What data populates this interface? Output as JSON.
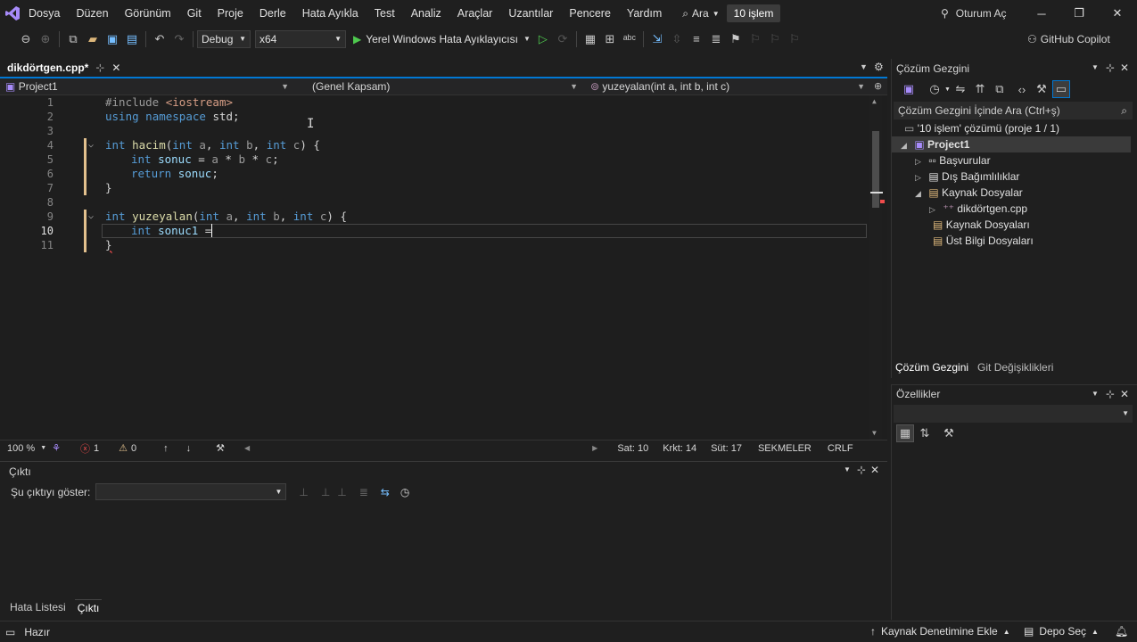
{
  "menubar": {
    "logo_text": "Dosya",
    "items": [
      "Düzen",
      "Görünüm",
      "Git",
      "Proje",
      "Derle",
      "Hata Ayıkla",
      "Test",
      "Analiz",
      "Araçlar",
      "Uzantılar",
      "Pencere",
      "Yardım"
    ],
    "search_label": "Ara",
    "solution_badge": "10 işlem",
    "signin_label": "Oturum Aç"
  },
  "toolbar": {
    "config": "Debug",
    "platform": "x64",
    "debugger_label": "Yerel Windows Hata Ayıklayıcısı",
    "copilot_label": "GitHub Copilot"
  },
  "editor": {
    "tab_label": "dikdörtgen.cpp*",
    "project_combo": "Project1",
    "scope_combo": "(Genel Kapsam)",
    "member_combo": "yuzeyalan(int a, int b, int c)",
    "line_numbers": [
      "1",
      "2",
      "3",
      "4",
      "5",
      "6",
      "7",
      "8",
      "9",
      "10",
      "11"
    ],
    "current_line": "10"
  },
  "editor_status": {
    "zoom": "100 %",
    "errors": "1",
    "warnings": "0",
    "line": "Sat: 10",
    "char": "Krkt: 14",
    "col": "Süt: 17",
    "tabs": "SEKMELER",
    "eol": "CRLF"
  },
  "output": {
    "title": "Çıktı",
    "show_from_label": "Şu çıktıyı göster:",
    "tabs": [
      "Hata Listesi",
      "Çıktı"
    ]
  },
  "solution_explorer": {
    "title": "Çözüm Gezgini",
    "search_placeholder": "Çözüm Gezgini İçinde Ara (Ctrl+ş)",
    "tree": [
      "'10 işlem' çözümü (proje 1 / 1)",
      "Project1",
      "Başvurular",
      "Dış Bağımlılıklar",
      "Kaynak Dosyalar",
      "dikdörtgen.cpp",
      "Kaynak Dosyaları",
      "Üst Bilgi Dosyaları"
    ],
    "bottom_tabs": [
      "Çözüm Gezgini",
      "Git Değişiklikleri"
    ]
  },
  "properties": {
    "title": "Özellikler"
  },
  "app_status": {
    "ready": "Hazır",
    "source_control": "Kaynak Denetimine Ekle",
    "repo": "Depo Seç"
  }
}
